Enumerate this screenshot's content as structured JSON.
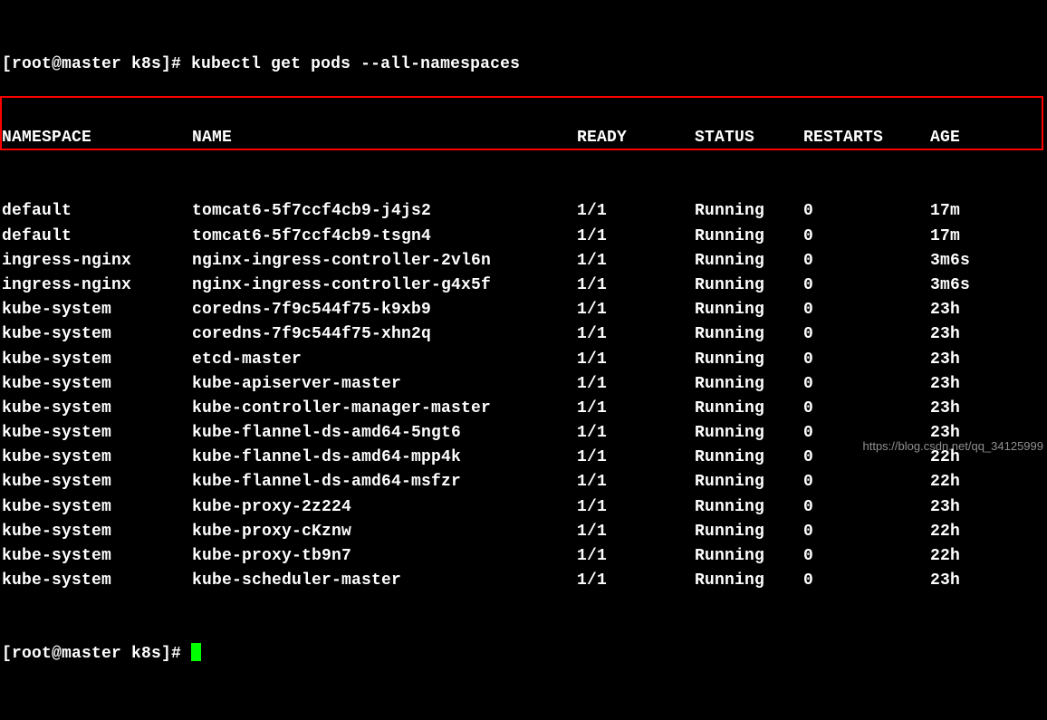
{
  "prompt1_user": "[root@master k8s]# ",
  "command": "kubectl get pods --all-namespaces",
  "headers": {
    "namespace": "NAMESPACE",
    "name": "NAME",
    "ready": "READY",
    "status": "STATUS",
    "restarts": "RESTARTS",
    "age": "AGE"
  },
  "rows": [
    {
      "namespace": "default",
      "name": "tomcat6-5f7ccf4cb9-j4js2",
      "ready": "1/1",
      "status": "Running",
      "restarts": "0",
      "age": "17m",
      "hl": false
    },
    {
      "namespace": "default",
      "name": "tomcat6-5f7ccf4cb9-tsgn4",
      "ready": "1/1",
      "status": "Running",
      "restarts": "0",
      "age": "17m",
      "hl": false
    },
    {
      "namespace": "ingress-nginx",
      "name": "nginx-ingress-controller-2vl6n",
      "ready": "1/1",
      "status": "Running",
      "restarts": "0",
      "age": "3m6s",
      "hl": true
    },
    {
      "namespace": "ingress-nginx",
      "name": "nginx-ingress-controller-g4x5f",
      "ready": "1/1",
      "status": "Running",
      "restarts": "0",
      "age": "3m6s",
      "hl": true
    },
    {
      "namespace": "kube-system",
      "name": "coredns-7f9c544f75-k9xb9",
      "ready": "1/1",
      "status": "Running",
      "restarts": "0",
      "age": "23h",
      "hl": false
    },
    {
      "namespace": "kube-system",
      "name": "coredns-7f9c544f75-xhn2q",
      "ready": "1/1",
      "status": "Running",
      "restarts": "0",
      "age": "23h",
      "hl": false
    },
    {
      "namespace": "kube-system",
      "name": "etcd-master",
      "ready": "1/1",
      "status": "Running",
      "restarts": "0",
      "age": "23h",
      "hl": false
    },
    {
      "namespace": "kube-system",
      "name": "kube-apiserver-master",
      "ready": "1/1",
      "status": "Running",
      "restarts": "0",
      "age": "23h",
      "hl": false
    },
    {
      "namespace": "kube-system",
      "name": "kube-controller-manager-master",
      "ready": "1/1",
      "status": "Running",
      "restarts": "0",
      "age": "23h",
      "hl": false
    },
    {
      "namespace": "kube-system",
      "name": "kube-flannel-ds-amd64-5ngt6",
      "ready": "1/1",
      "status": "Running",
      "restarts": "0",
      "age": "23h",
      "hl": false
    },
    {
      "namespace": "kube-system",
      "name": "kube-flannel-ds-amd64-mpp4k",
      "ready": "1/1",
      "status": "Running",
      "restarts": "0",
      "age": "22h",
      "hl": false
    },
    {
      "namespace": "kube-system",
      "name": "kube-flannel-ds-amd64-msfzr",
      "ready": "1/1",
      "status": "Running",
      "restarts": "0",
      "age": "22h",
      "hl": false
    },
    {
      "namespace": "kube-system",
      "name": "kube-proxy-2z224",
      "ready": "1/1",
      "status": "Running",
      "restarts": "0",
      "age": "23h",
      "hl": false
    },
    {
      "namespace": "kube-system",
      "name": "kube-proxy-cKznw",
      "ready": "1/1",
      "status": "Running",
      "restarts": "0",
      "age": "22h",
      "hl": false
    },
    {
      "namespace": "kube-system",
      "name": "kube-proxy-tb9n7",
      "ready": "1/1",
      "status": "Running",
      "restarts": "0",
      "age": "22h",
      "hl": false
    },
    {
      "namespace": "kube-system",
      "name": "kube-scheduler-master",
      "ready": "1/1",
      "status": "Running",
      "restarts": "0",
      "age": "23h",
      "hl": false
    }
  ],
  "prompt2_user": "[root@master k8s]# ",
  "watermark": "https://blog.csdn.net/qq_34125999"
}
